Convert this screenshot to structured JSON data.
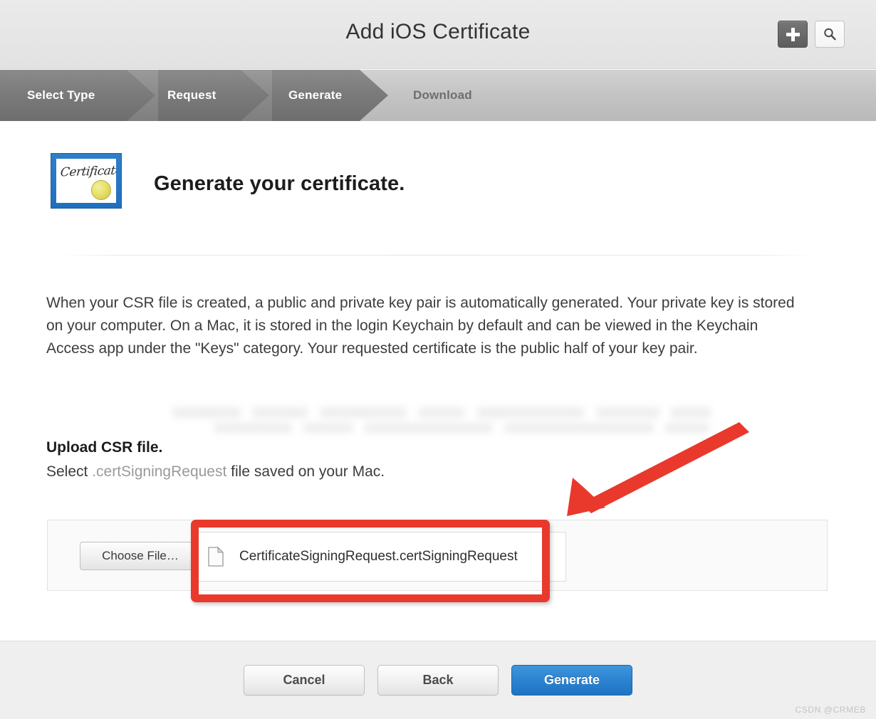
{
  "header": {
    "title": "Add iOS Certificate",
    "add_button_label": "+",
    "add_icon": "plus-icon",
    "search_icon": "search-icon"
  },
  "steps": [
    {
      "label": "Select Type",
      "state": "done"
    },
    {
      "label": "Request",
      "state": "done"
    },
    {
      "label": "Generate",
      "state": "current"
    },
    {
      "label": "Download",
      "state": "upcoming"
    }
  ],
  "main": {
    "icon_name": "certificate-icon",
    "certificate_icon_text": "Certificate",
    "heading": "Generate your certificate.",
    "paragraph": "When your CSR file is created, a public and private key pair is automatically generated. Your private key is stored on your computer. On a Mac, it is stored in the login Keychain by default and can be viewed in the Keychain Access app under the \"Keys\" category. Your requested certificate is the public half of your key pair.",
    "upload_title": "Upload CSR file.",
    "upload_sub_prefix": "Select ",
    "upload_sub_highlight": ".certSigningRequest",
    "upload_sub_suffix": " file saved on your Mac.",
    "choose_file_label": "Choose File…",
    "file_name": "CertificateSigningRequest.certSigningRequest",
    "file_icon": "document-icon"
  },
  "annotations": {
    "highlight_color": "#E8392C",
    "arrow_name": "red-pointer-arrow",
    "file_box_name": "file-highlight-box",
    "generate_box_name": "generate-highlight-box"
  },
  "footer": {
    "cancel_label": "Cancel",
    "back_label": "Back",
    "generate_label": "Generate"
  },
  "watermark": "CSDN @CRMEB"
}
